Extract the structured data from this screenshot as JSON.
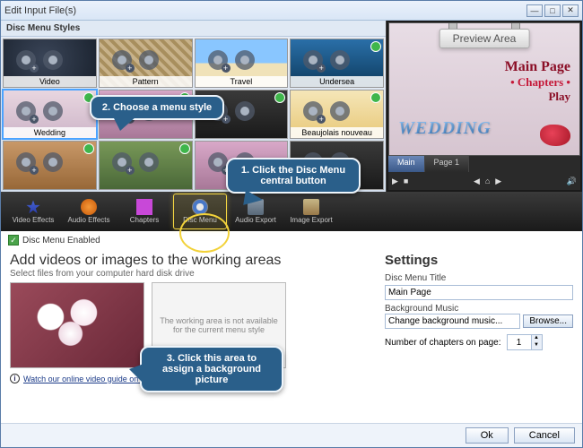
{
  "window": {
    "title": "Edit Input File(s)"
  },
  "styles": {
    "header": "Disc Menu Styles",
    "items": [
      {
        "label": "Video",
        "thumb": "video",
        "badge": false
      },
      {
        "label": "Pattern",
        "thumb": "pattern",
        "badge": false
      },
      {
        "label": "Travel",
        "thumb": "travel",
        "badge": false
      },
      {
        "label": "Undersea",
        "thumb": "undersea",
        "badge": true
      },
      {
        "label": "Wedding",
        "thumb": "wedding",
        "badge": true,
        "selected": true
      },
      {
        "label": "",
        "thumb": "generic1",
        "badge": true
      },
      {
        "label": "",
        "thumb": "generic2",
        "badge": true
      },
      {
        "label": "Beaujolais nouveau",
        "thumb": "beaujolais",
        "badge": true
      },
      {
        "label": "",
        "thumb": "generic3",
        "badge": true
      },
      {
        "label": "",
        "thumb": "generic4",
        "badge": true
      },
      {
        "label": "",
        "thumb": "generic1",
        "badge": false
      },
      {
        "label": "",
        "thumb": "generic2",
        "badge": false
      }
    ]
  },
  "preview": {
    "label": "Preview Area",
    "main_page": "Main Page",
    "chapters": "• Chapters •",
    "play": "Play",
    "decor_text": "WEDDING",
    "tabs": [
      "Main",
      "Page 1"
    ],
    "active_tab": 0
  },
  "tools": [
    {
      "label": "Video Effects",
      "icon": "ve"
    },
    {
      "label": "Audio Effects",
      "icon": "ae"
    },
    {
      "label": "Chapters",
      "icon": "ch"
    },
    {
      "label": "Disc Menu",
      "icon": "dm",
      "active": true
    },
    {
      "label": "Audio Export",
      "icon": "ax"
    },
    {
      "label": "Image Export",
      "icon": "ix"
    }
  ],
  "status": {
    "text": "Disc Menu Enabled"
  },
  "lower": {
    "heading": "Add videos or images to the working areas",
    "subheading": "Select files from your computer hard disk drive",
    "area2_note": "The working area is not available for the current menu style",
    "guide_text": "Watch our online video guide on how to create a disc menu"
  },
  "settings": {
    "title": "Settings",
    "disc_title_label": "Disc Menu Title",
    "disc_title_value": "Main Page",
    "bg_music_label": "Background Music",
    "bg_music_value": "Change background music...",
    "browse": "Browse...",
    "chapters_label": "Number of chapters on page:",
    "chapters_value": "1"
  },
  "footer": {
    "ok": "Ok",
    "cancel": "Cancel"
  },
  "callouts": {
    "c1": "1. Click the Disc Menu central button",
    "c2": "2. Choose a menu style",
    "c3": "3. Click this area to assign a background picture"
  }
}
